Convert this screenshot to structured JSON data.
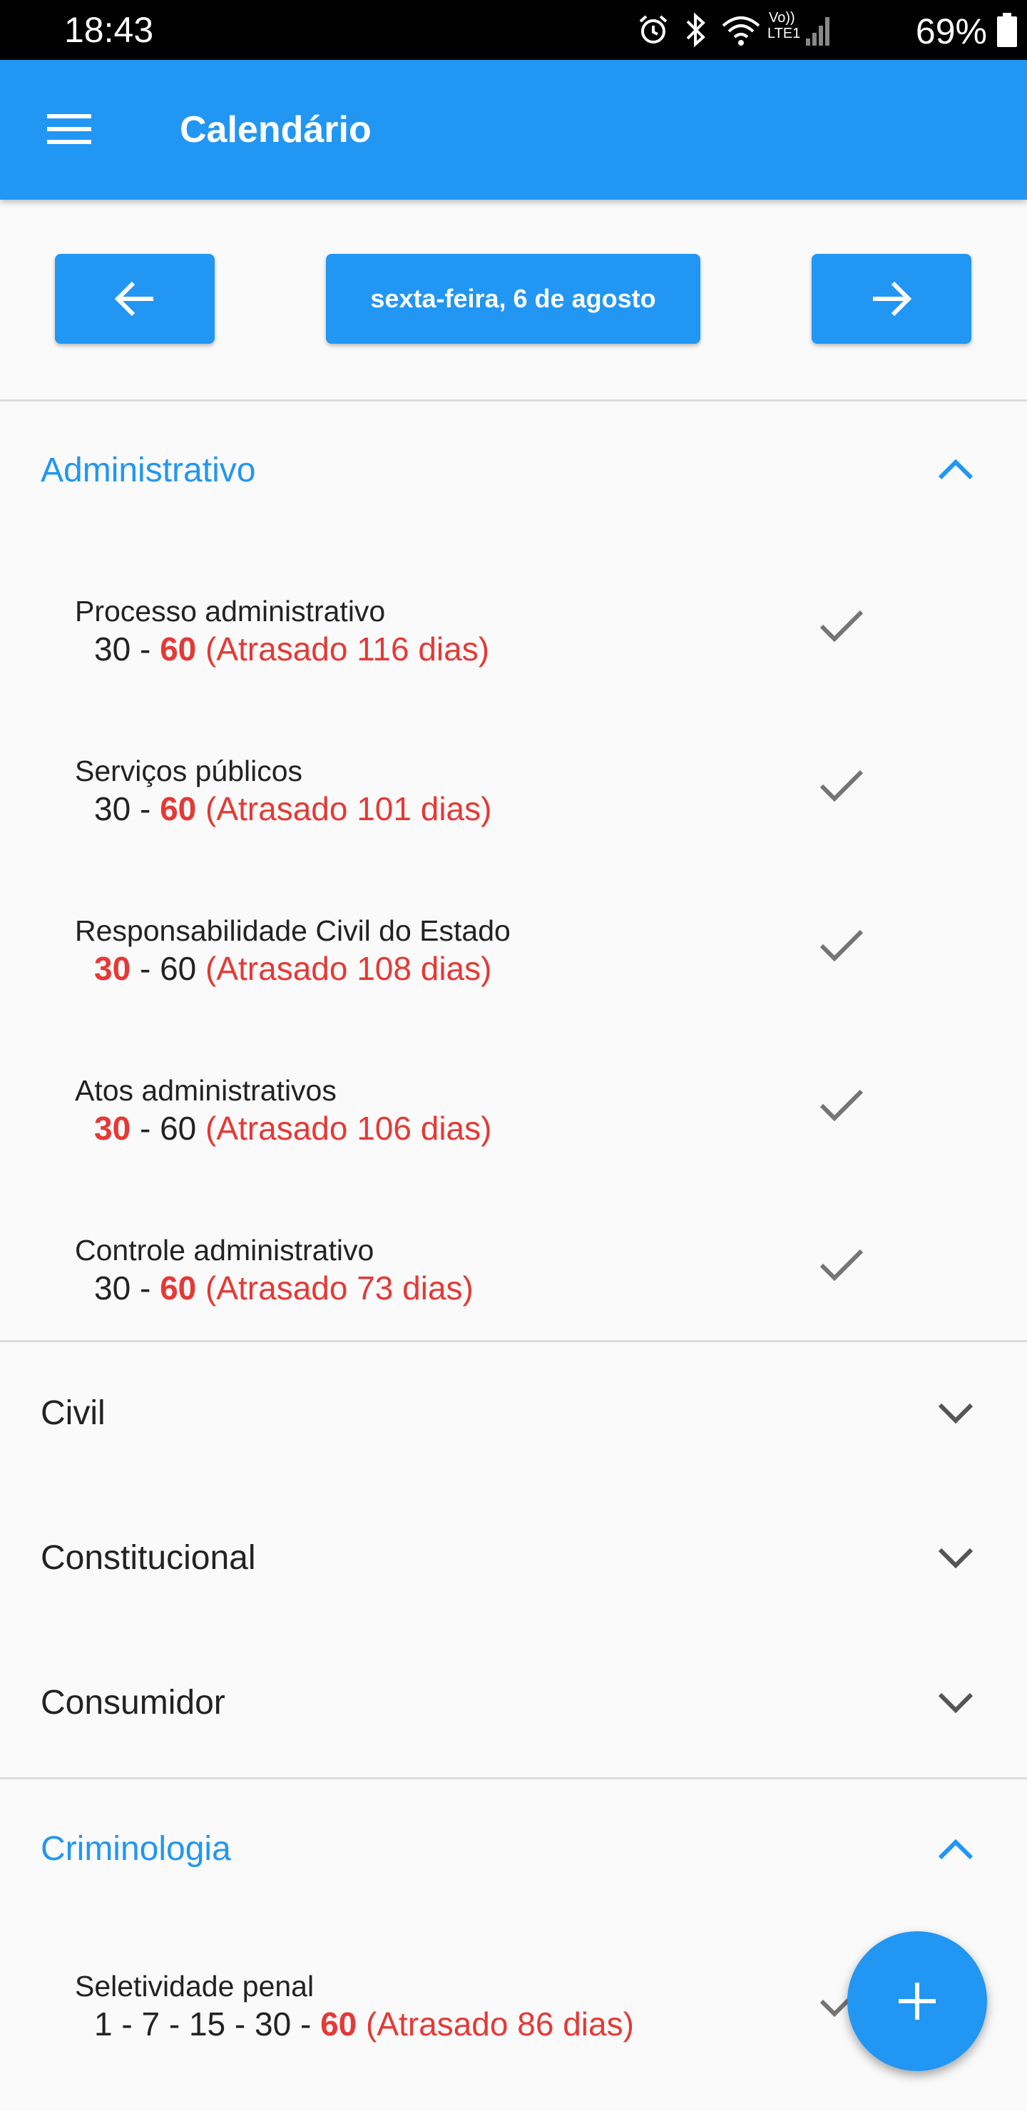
{
  "status_bar": {
    "time": "18:43",
    "battery_text": "69%",
    "lte_label": "LTE1",
    "volte_label": "Vo))",
    "icons": [
      "alarm-icon",
      "bluetooth-icon",
      "wifi-icon",
      "signal-icon",
      "battery-icon"
    ]
  },
  "app_bar": {
    "title": "Calendário",
    "menu_icon": "menu-icon"
  },
  "date_nav": {
    "current_date": "sexta-feira, 6 de agosto",
    "prev_icon": "arrow-left-icon",
    "next_icon": "arrow-right-icon"
  },
  "sections": [
    {
      "title": "Administrativo",
      "expanded": true,
      "items": [
        {
          "name": "Processo administrativo",
          "sep": " - ",
          "parts": [
            "30",
            "60"
          ],
          "highlight": 1,
          "late": "(Atrasado 116 dias)"
        },
        {
          "name": "Serviços públicos",
          "sep": " - ",
          "parts": [
            "30",
            "60"
          ],
          "highlight": 1,
          "late": "(Atrasado 101 dias)"
        },
        {
          "name": "Responsabilidade Civil do Estado",
          "sep": " - ",
          "parts": [
            "30",
            "60"
          ],
          "highlight": 0,
          "late": "(Atrasado 108 dias)"
        },
        {
          "name": "Atos administrativos",
          "sep": " - ",
          "parts": [
            "30",
            "60"
          ],
          "highlight": 0,
          "late": "(Atrasado 106 dias)"
        },
        {
          "name": "Controle administrativo",
          "sep": " - ",
          "parts": [
            "30",
            "60"
          ],
          "highlight": 1,
          "late": "(Atrasado 73 dias)"
        }
      ]
    },
    {
      "title": "Civil",
      "expanded": false,
      "items": []
    },
    {
      "title": "Constitucional",
      "expanded": false,
      "items": []
    },
    {
      "title": "Consumidor",
      "expanded": false,
      "items": []
    },
    {
      "title": "Criminologia",
      "expanded": true,
      "items": [
        {
          "name": "Seletividade penal",
          "sep": " - ",
          "parts": [
            "1",
            "7",
            "15",
            "30",
            "60"
          ],
          "highlight": 4,
          "late": "(Atrasado 86 dias)"
        }
      ]
    }
  ],
  "fab": {
    "icon": "plus-icon"
  },
  "colors": {
    "primary": "#2196f3",
    "overdue": "#e53935",
    "check": "#757575"
  }
}
